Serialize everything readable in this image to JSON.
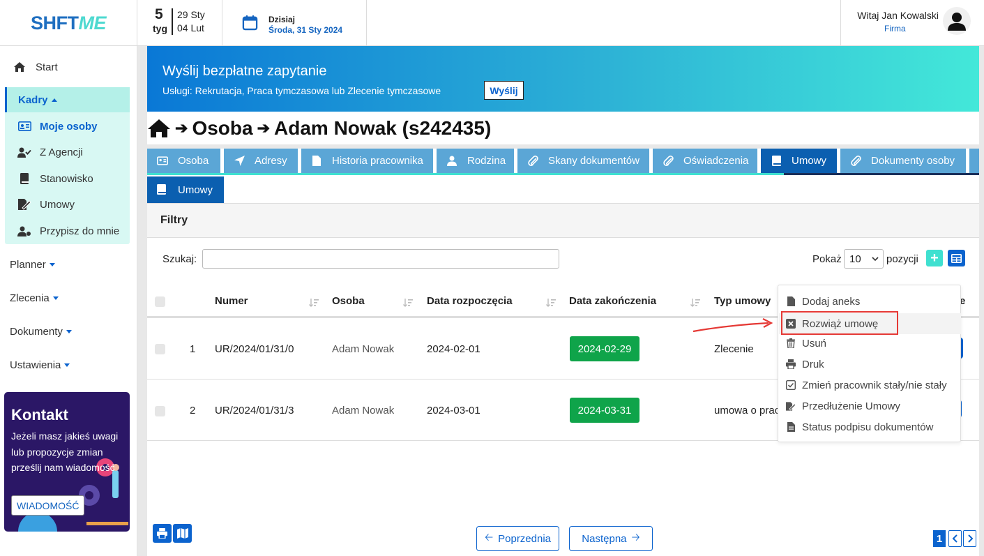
{
  "app": {
    "logo_left": "SHFT",
    "logo_right": "ME"
  },
  "header": {
    "week_number": "5",
    "week_label": "tyg",
    "week_start": "29 Sty",
    "week_end": "04 Lut",
    "today_label": "Dzisiaj",
    "today_date": "Środa, 31 Sty 2024",
    "greeting": "Witaj Jan Kowalski",
    "company": "Firma"
  },
  "sidebar": {
    "start": "Start",
    "kadry": "Kadry",
    "kadry_items": [
      "Moje osoby",
      "Z Agencji",
      "Stanowisko",
      "Umowy",
      "Przypisz do mnie"
    ],
    "menus": [
      "Planner",
      "Zlecenia",
      "Dokumenty",
      "Ustawienia"
    ],
    "contact": {
      "title": "Kontakt",
      "text": "Jeżeli masz jakieś uwagi lub propozycje zmian prześlij nam wiadomość",
      "button": "WIADOMOŚĆ"
    }
  },
  "banner": {
    "title": "Wyślij bezpłatne zapytanie",
    "subtitle": "Usługi: Rekrutacja, Praca tymczasowa lub Zlecenie tymczasowe",
    "button": "Wyślij"
  },
  "breadcrumb": {
    "level1": "Osoba",
    "level2": "Adam Nowak (s242435)"
  },
  "tabs": [
    "Osoba",
    "Adresy",
    "Historia pracownika",
    "Rodzina",
    "Skany dokumentów",
    "Oświadczenia",
    "Umowy",
    "Dokumenty osoby"
  ],
  "active_tab": "Umowy",
  "subtab": "Umowy",
  "filters": {
    "title": "Filtry",
    "search_label": "Szukaj:",
    "search_value": "",
    "show_label": "Pokaż",
    "show_value": "10",
    "show_suffix": "pozycji"
  },
  "table": {
    "columns": [
      "Numer",
      "Osoba",
      "Data rozpoczęcia",
      "Data zakończenia",
      "Typ umowy"
    ],
    "rows": [
      {
        "index": "1",
        "numer": "UR/2024/01/31/0",
        "osoba": "Adam Nowak",
        "start": "2024-02-01",
        "end": "2024-02-29",
        "typ": "Zlecenie"
      },
      {
        "index": "2",
        "numer": "UR/2024/01/31/3",
        "osoba": "Adam Nowak",
        "start": "2024-03-01",
        "end": "2024-03-31",
        "typ": "umowa o prac"
      }
    ],
    "partial_column_tail": "e"
  },
  "dropdown": {
    "items": [
      "Dodaj aneks",
      "Rozwiąż umowę",
      "Usuń",
      "Druk",
      "Zmień pracownik stały/nie stały",
      "Przedłużenie Umowy",
      "Status podpisu dokumentów"
    ],
    "highlighted": "Rozwiąż umowę"
  },
  "pagination": {
    "prev": "Poprzednia",
    "next": "Następna",
    "current_page": "1"
  },
  "colors": {
    "primary": "#0b63ce",
    "accent": "#3fe0d0",
    "success": "#0fa44a",
    "annotation": "#e53935"
  }
}
